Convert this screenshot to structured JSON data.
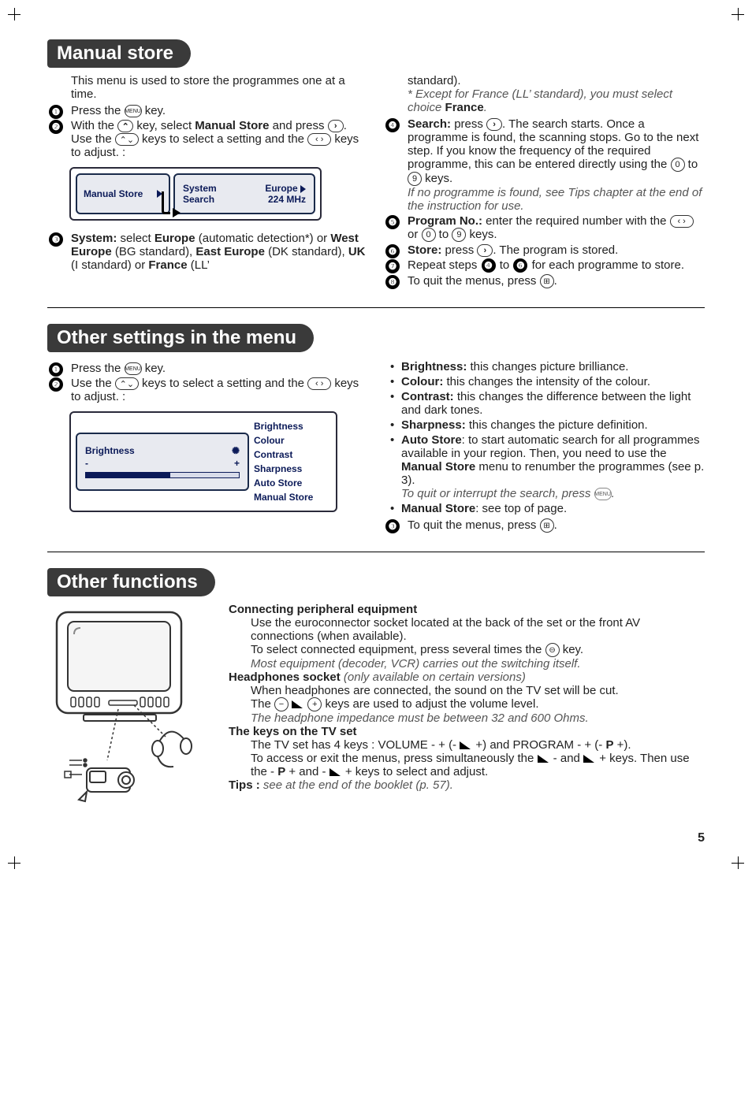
{
  "section1": {
    "heading": "Manual store",
    "intro": "This menu is used to store the programmes one at a time.",
    "step1a": "Press the ",
    "step1b": " key.",
    "step2a": "With the ",
    "step2b": " key, select ",
    "step2_bold": "Manual Store",
    "step2c": " and press ",
    "step2d": ". Use the ",
    "step2e": " keys to select a setting and the ",
    "step2f": " keys to adjust. :",
    "shot_left": "Manual Store",
    "shot_r1a": "System",
    "shot_r1b": "Europe",
    "shot_r2a": "Search",
    "shot_r2b": "224 MHz",
    "step3a": "System:",
    "step3b": " select ",
    "step3c": "Europe",
    "step3d": " (automatic detection*) or ",
    "step3e": "West Europe",
    "step3f": " (BG standard), ",
    "step3g": "East Europe",
    "step3h": " (DK standard), ",
    "step3i": "UK",
    "step3j": " (I standard) or ",
    "step3k": "France",
    "step3l": " (LL’",
    "right_top": "standard).",
    "right_note1": "* Except for France (LL’ standard), you must select choice ",
    "right_note1b": "France",
    "right_note1c": ".",
    "step4a": "Search:",
    "step4b": " press ",
    "step4c": ". The search starts. Once a programme is found, the scanning stops. Go to the next step. If you know the frequency of the required programme, this can be entered directly using the ",
    "step4d": " to ",
    "step4e": " keys.",
    "step4_it": "If no programme is found, see Tips chapter at the end of the instruction for use.",
    "step5a": "Program No.:",
    "step5b": " enter the required number with the ",
    "step5c": " or ",
    "step5d": " to ",
    "step5e": " keys.",
    "step6a": "Store:",
    "step6b": " press ",
    "step6c": ". The program is stored.",
    "step7a": "Repeat steps ",
    "step7b": " to ",
    "step7c": " for each programme to store.",
    "step8a": "To quit the menus, press ",
    "step8b": "."
  },
  "section2": {
    "heading": "Other settings in the menu",
    "step1a": "Press the ",
    "step1b": " key.",
    "step2a": "Use the ",
    "step2b": " keys to select a setting and the ",
    "step2c": " keys to adjust. :",
    "shot_left_label": "Brightness",
    "shot_minus": "-",
    "shot_plus": "+",
    "list1": "Brightness",
    "list2": "Colour",
    "list3": "Contrast",
    "list4": "Sharpness",
    "list5": "Auto Store",
    "list6": "Manual Store",
    "b1a": "Brightness:",
    "b1b": " this changes picture brilliance.",
    "b2a": "Colour:",
    "b2b": " this changes the intensity of the colour.",
    "b3a": "Contrast:",
    "b3b": " this changes the difference between the light and dark tones.",
    "b4a": "Sharpness:",
    "b4b": " this changes the picture definition.",
    "b5a": "Auto Store",
    "b5b": ": to start automatic search for all programmes available in your region. Then, you need to use the ",
    "b5c": "Manual Store",
    "b5d": " menu to renumber the programmes (see p. 3).",
    "b5_it1": "To quit or interrupt the search, press ",
    "b5_it2": ".",
    "b6a": "Manual Store",
    "b6b": ": see top of page.",
    "step3a": "To quit the menus, press ",
    "step3b": "."
  },
  "section3": {
    "heading": "Other functions",
    "h1": "Connecting peripheral equipment",
    "p1": "Use the euroconnector socket located at the back of the set or the front AV connections (when available).",
    "p2a": "To select connected equipment, press several times the ",
    "p2b": " key.",
    "p2_it": "Most equipment (decoder, VCR) carries out the switching itself.",
    "h2a": "Headphones socket",
    "h2b": " (only available on certain versions)",
    "p3": "When headphones are connected, the sound on the TV set will be cut.",
    "p4a": "The ",
    "p4b": " keys are used to adjust the volume level.",
    "p4_it": "The headphone impedance must be between 32 and 600 Ohms.",
    "h3": "The keys on the TV set",
    "p5a": "The TV set has 4 keys : VOLUME - + (- ",
    "p5b": " +) and PROGRAM - + (- ",
    "p5c": "P",
    "p5d": " +).",
    "p6a": "To access or exit the menus, press simultaneously the ",
    "p6b": " - and ",
    "p6c": " + keys. Then use the - ",
    "p6d": "P",
    "p6e": " + and - ",
    "p6f": " + keys to select and adjust.",
    "tips_a": "Tips :",
    "tips_b": " see at the end of the booklet (p. 57)."
  },
  "pagenum": "5",
  "keys": {
    "k0": "0",
    "k9": "9"
  }
}
